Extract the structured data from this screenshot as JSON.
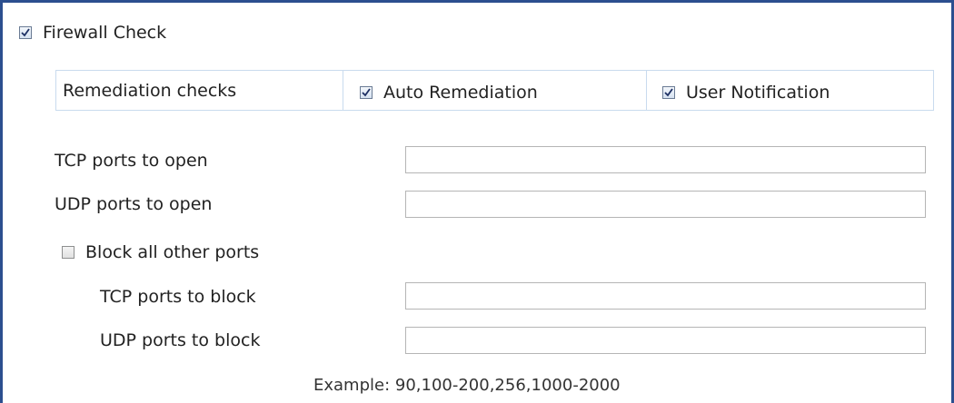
{
  "firewall_check": {
    "label": "Firewall Check",
    "checked": true
  },
  "remediation": {
    "label": "Remediation checks",
    "auto_remediation": {
      "label": "Auto Remediation",
      "checked": true
    },
    "user_notification": {
      "label": "User Notification",
      "checked": true
    }
  },
  "ports": {
    "tcp_open": {
      "label": "TCP ports to open",
      "value": ""
    },
    "udp_open": {
      "label": "UDP ports to open",
      "value": ""
    },
    "block_all": {
      "label": "Block all other ports",
      "checked": false
    },
    "tcp_block": {
      "label": "TCP ports to block",
      "value": ""
    },
    "udp_block": {
      "label": "UDP ports to block",
      "value": ""
    },
    "example": "Example: 90,100-200,256,1000-2000"
  },
  "colors": {
    "frame_border": "#2c4f8f",
    "table_border": "#c9dbee",
    "input_border": "#b5b5b5"
  },
  "icons": {
    "checkmark": "checkmark-icon"
  }
}
